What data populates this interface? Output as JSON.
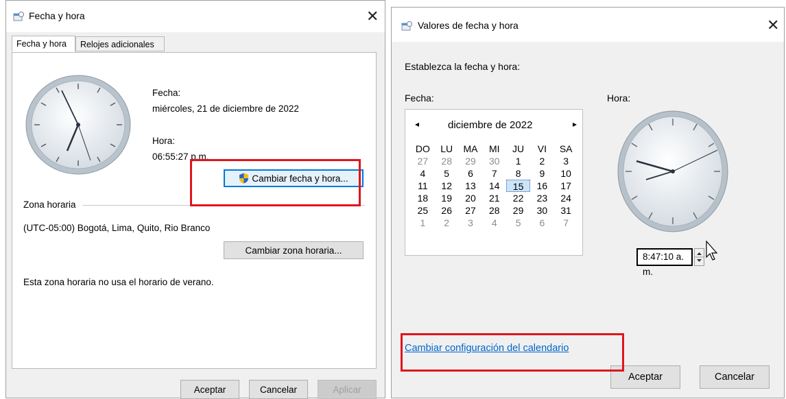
{
  "left_dialog": {
    "title": "Fecha y hora",
    "close_glyph": "✕",
    "tabs": [
      {
        "label": "Fecha y hora",
        "active": true
      },
      {
        "label": "Relojes adicionales",
        "active": false
      }
    ],
    "date_label": "Fecha:",
    "date_value": "miércoles, 21 de diciembre de 2022",
    "time_label": "Hora:",
    "time_value": "06:55:27 p.m.",
    "change_datetime_button": "Cambiar fecha y hora...",
    "timezone_group_label": "Zona horaria",
    "timezone_value": "(UTC-05:00) Bogotá, Lima, Quito, Rio Branco",
    "change_timezone_button": "Cambiar zona horaria...",
    "dst_note": "Esta zona horaria no usa el horario de verano.",
    "buttons": {
      "ok": "Aceptar",
      "cancel": "Cancelar",
      "apply": "Aplicar"
    }
  },
  "right_dialog": {
    "title": "Valores de fecha y hora",
    "close_glyph": "✕",
    "instruction": "Establezca la fecha y hora:",
    "date_label": "Fecha:",
    "time_label": "Hora:",
    "calendar": {
      "month_label": "diciembre de 2022",
      "prev_glyph": "◂",
      "next_glyph": "▸",
      "weekdays": [
        "DO",
        "LU",
        "MA",
        "MI",
        "JU",
        "VI",
        "SA"
      ],
      "weeks": [
        [
          "27",
          "28",
          "29",
          "30",
          "1",
          "2",
          "3"
        ],
        [
          "4",
          "5",
          "6",
          "7",
          "8",
          "9",
          "10"
        ],
        [
          "11",
          "12",
          "13",
          "14",
          "15",
          "16",
          "17"
        ],
        [
          "18",
          "19",
          "20",
          "21",
          "22",
          "23",
          "24"
        ],
        [
          "25",
          "26",
          "27",
          "28",
          "29",
          "30",
          "31"
        ],
        [
          "1",
          "2",
          "3",
          "4",
          "5",
          "6",
          "7"
        ]
      ],
      "selected_day": "15"
    },
    "time_input": "8:47:10 a. m.",
    "calendar_settings_link": "Cambiar configuración del calendario",
    "buttons": {
      "ok": "Aceptar",
      "cancel": "Cancelar"
    }
  },
  "colors": {
    "highlight_red": "#e0141c",
    "link_blue": "#0066cc",
    "focus_blue": "#0078d7"
  }
}
